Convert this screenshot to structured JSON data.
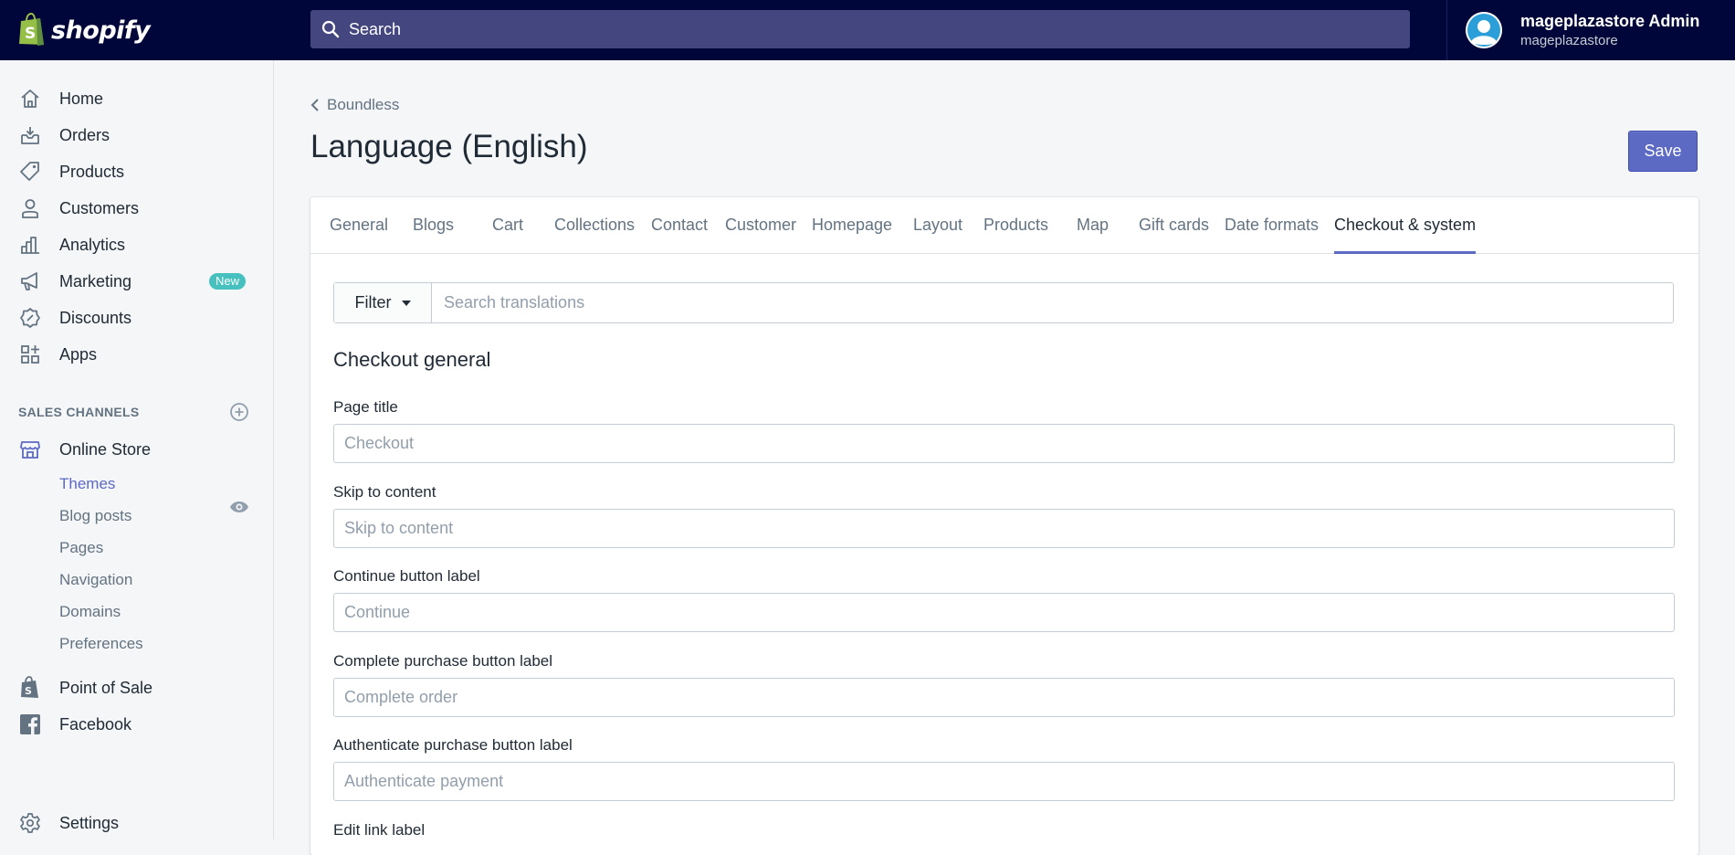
{
  "brand": {
    "name": "shopify"
  },
  "search": {
    "label": "Search"
  },
  "account": {
    "name": "mageplazastore Admin",
    "store": "mageplazastore"
  },
  "sidebar": {
    "items": [
      {
        "label": "Home",
        "icon": "home-icon"
      },
      {
        "label": "Orders",
        "icon": "orders-icon"
      },
      {
        "label": "Products",
        "icon": "tag-icon"
      },
      {
        "label": "Customers",
        "icon": "person-icon"
      },
      {
        "label": "Analytics",
        "icon": "bar-chart-icon"
      },
      {
        "label": "Marketing",
        "icon": "megaphone-icon",
        "badge": "New"
      },
      {
        "label": "Discounts",
        "icon": "discount-icon"
      },
      {
        "label": "Apps",
        "icon": "apps-icon"
      }
    ],
    "sales_channels_title": "SALES CHANNELS",
    "online_store": {
      "label": "Online Store"
    },
    "online_store_subitems": [
      "Themes",
      "Blog posts",
      "Pages",
      "Navigation",
      "Domains",
      "Preferences"
    ],
    "point_of_sale": {
      "label": "Point of Sale"
    },
    "facebook": {
      "label": "Facebook"
    },
    "settings": {
      "label": "Settings"
    }
  },
  "breadcrumb": {
    "label": "Boundless"
  },
  "page": {
    "title": "Language (English)",
    "save_label": "Save"
  },
  "tabs": [
    "General",
    "Blogs",
    "Cart",
    "Collections",
    "Contact",
    "Customer",
    "Homepage",
    "Layout",
    "Products",
    "Map",
    "Gift cards",
    "Date formats",
    "Checkout & system"
  ],
  "active_tab": "Checkout & system",
  "filter": {
    "button_label": "Filter",
    "placeholder": "Search translations"
  },
  "section": {
    "title": "Checkout general"
  },
  "fields": [
    {
      "label": "Page title",
      "placeholder": "Checkout"
    },
    {
      "label": "Skip to content",
      "placeholder": "Skip to content"
    },
    {
      "label": "Continue button label",
      "placeholder": "Continue"
    },
    {
      "label": "Complete purchase button label",
      "placeholder": "Complete order"
    },
    {
      "label": "Authenticate purchase button label",
      "placeholder": "Authenticate payment"
    },
    {
      "label": "Edit link label",
      "placeholder": ""
    }
  ],
  "colors": {
    "topbar": "#000639",
    "search_bg": "#43467f",
    "accent": "#5c6ac4",
    "badge": "#47c1bf",
    "shopify_green": "#95bf47"
  }
}
